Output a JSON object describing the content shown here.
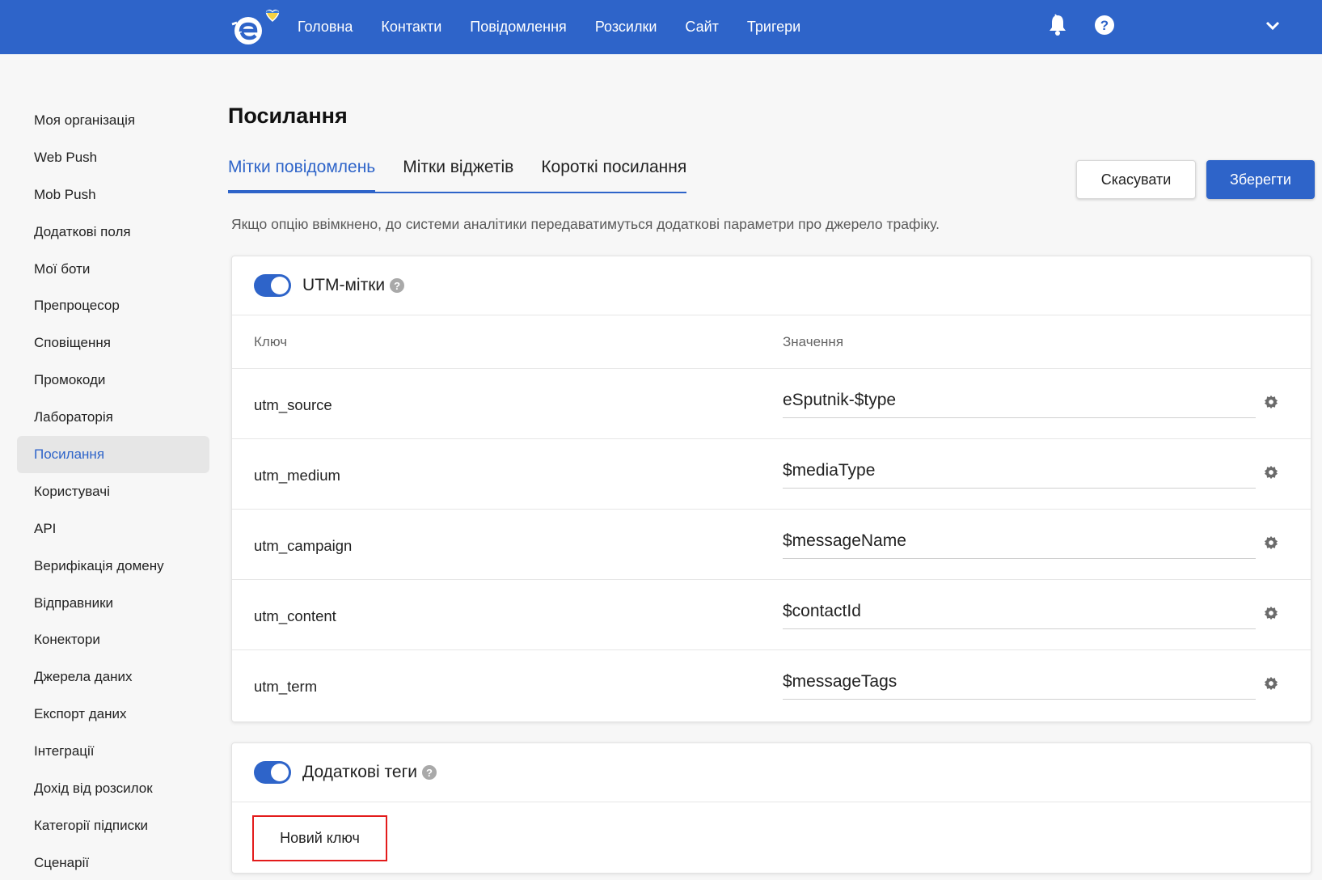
{
  "header": {
    "nav": [
      "Головна",
      "Контакти",
      "Повідомлення",
      "Розсилки",
      "Сайт",
      "Тригери"
    ]
  },
  "sidebar": {
    "items": [
      "Моя організація",
      "Web Push",
      "Mob Push",
      "Додаткові поля",
      "Мої боти",
      "Препроцесор",
      "Сповіщення",
      "Промокоди",
      "Лабораторія",
      "Посилання",
      "Користувачі",
      "API",
      "Верифікація домену",
      "Відправники",
      "Конектори",
      "Джерела даних",
      "Експорт даних",
      "Інтеграції",
      "Дохід від розсилок",
      "Категорії підписки",
      "Сценарії"
    ],
    "active_index": 9
  },
  "page": {
    "title": "Посилання",
    "tabs": [
      "Мітки повідомлень",
      "Мітки віджетів",
      "Короткі посилання"
    ],
    "active_tab": 0,
    "cancel_label": "Скасувати",
    "save_label": "Зберегти",
    "hint": "Якщо опцію ввімкнено, до системи аналітики передаватимуться додаткові параметри про джерело трафіку."
  },
  "utm": {
    "title": "UTM-мітки",
    "enabled": true,
    "help_glyph": "?",
    "col_key": "Ключ",
    "col_value": "Значення",
    "rows": [
      {
        "key": "utm_source",
        "value": "eSputnik-$type"
      },
      {
        "key": "utm_medium",
        "value": "$mediaType"
      },
      {
        "key": "utm_campaign",
        "value": "$messageName"
      },
      {
        "key": "utm_content",
        "value": "$contactId"
      },
      {
        "key": "utm_term",
        "value": "$messageTags"
      }
    ]
  },
  "extra_tags": {
    "title": "Додаткові теги",
    "enabled": true,
    "help_glyph": "?",
    "new_key_label": "Новий ключ"
  },
  "icons": {
    "logo": "esputnik-logo-with-heart",
    "bell": "bell-icon",
    "help": "help-circle-icon",
    "chevron": "chevron-down-icon",
    "gear": "gear-icon"
  },
  "colors": {
    "brand_blue": "#2e64c9",
    "highlight_red": "#e31b1b",
    "heart_blue": "#3a7bd5",
    "heart_yellow": "#f5d142"
  }
}
